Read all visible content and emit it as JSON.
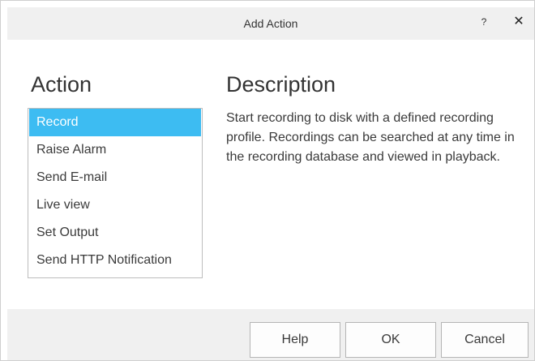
{
  "dialog": {
    "title": "Add Action",
    "help_glyph": "?",
    "close_glyph": "✕"
  },
  "left": {
    "heading": "Action",
    "items": [
      {
        "label": "Record",
        "selected": true
      },
      {
        "label": "Raise Alarm",
        "selected": false
      },
      {
        "label": "Send E-mail",
        "selected": false
      },
      {
        "label": "Live view",
        "selected": false
      },
      {
        "label": "Set Output",
        "selected": false
      },
      {
        "label": "Send HTTP Notification",
        "selected": false
      }
    ]
  },
  "right": {
    "heading": "Description",
    "text": "Start recording to disk with a defined recording profile. Recordings can be searched at any time in the recording database and viewed in playback."
  },
  "footer": {
    "help_label": "Help",
    "ok_label": "OK",
    "cancel_label": "Cancel"
  },
  "colors": {
    "selection": "#3dbcf2",
    "titlebar": "#f0f0f0",
    "footer": "#f0f0f0"
  }
}
